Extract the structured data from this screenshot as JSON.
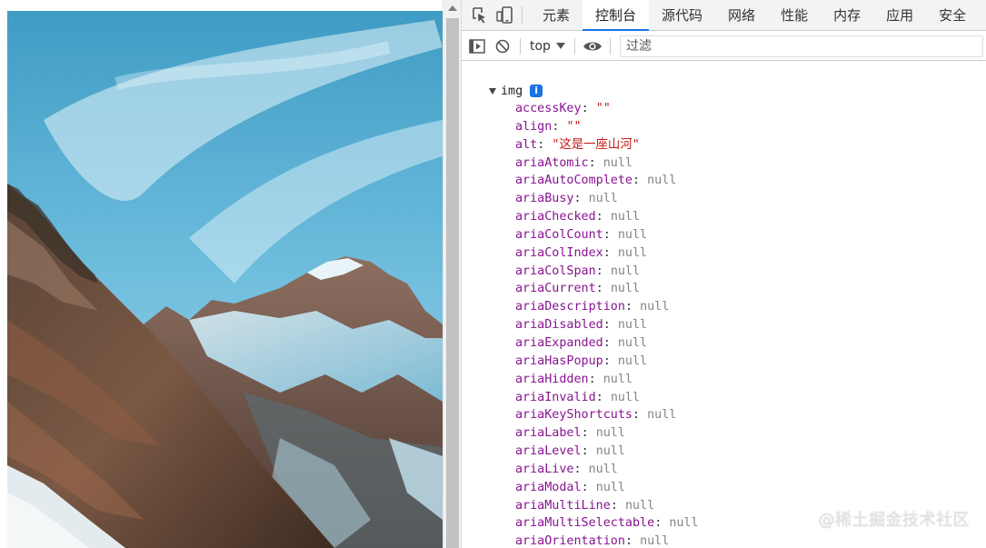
{
  "page": {
    "image_alt": "这是一座山河"
  },
  "devtools": {
    "tabs": [
      {
        "label": "元素",
        "active": false
      },
      {
        "label": "控制台",
        "active": true
      },
      {
        "label": "源代码",
        "active": false
      },
      {
        "label": "网络",
        "active": false
      },
      {
        "label": "性能",
        "active": false
      },
      {
        "label": "内存",
        "active": false
      },
      {
        "label": "应用",
        "active": false
      },
      {
        "label": "安全",
        "active": false
      }
    ],
    "toolbar": {
      "context": "top",
      "filter_placeholder": "过滤"
    },
    "accent_color": "#1a73e8"
  },
  "console": {
    "object_name": "img",
    "properties": [
      {
        "key": "accessKey",
        "value": "\"\"",
        "type": "string"
      },
      {
        "key": "align",
        "value": "\"\"",
        "type": "string"
      },
      {
        "key": "alt",
        "value": "\"这是一座山河\"",
        "type": "string"
      },
      {
        "key": "ariaAtomic",
        "value": "null",
        "type": "null"
      },
      {
        "key": "ariaAutoComplete",
        "value": "null",
        "type": "null"
      },
      {
        "key": "ariaBusy",
        "value": "null",
        "type": "null"
      },
      {
        "key": "ariaChecked",
        "value": "null",
        "type": "null"
      },
      {
        "key": "ariaColCount",
        "value": "null",
        "type": "null"
      },
      {
        "key": "ariaColIndex",
        "value": "null",
        "type": "null"
      },
      {
        "key": "ariaColSpan",
        "value": "null",
        "type": "null"
      },
      {
        "key": "ariaCurrent",
        "value": "null",
        "type": "null"
      },
      {
        "key": "ariaDescription",
        "value": "null",
        "type": "null"
      },
      {
        "key": "ariaDisabled",
        "value": "null",
        "type": "null"
      },
      {
        "key": "ariaExpanded",
        "value": "null",
        "type": "null"
      },
      {
        "key": "ariaHasPopup",
        "value": "null",
        "type": "null"
      },
      {
        "key": "ariaHidden",
        "value": "null",
        "type": "null"
      },
      {
        "key": "ariaInvalid",
        "value": "null",
        "type": "null"
      },
      {
        "key": "ariaKeyShortcuts",
        "value": "null",
        "type": "null"
      },
      {
        "key": "ariaLabel",
        "value": "null",
        "type": "null"
      },
      {
        "key": "ariaLevel",
        "value": "null",
        "type": "null"
      },
      {
        "key": "ariaLive",
        "value": "null",
        "type": "null"
      },
      {
        "key": "ariaModal",
        "value": "null",
        "type": "null"
      },
      {
        "key": "ariaMultiLine",
        "value": "null",
        "type": "null"
      },
      {
        "key": "ariaMultiSelectable",
        "value": "null",
        "type": "null"
      },
      {
        "key": "ariaOrientation",
        "value": "null",
        "type": "null"
      }
    ]
  },
  "watermark": "@稀土掘金技术社区"
}
